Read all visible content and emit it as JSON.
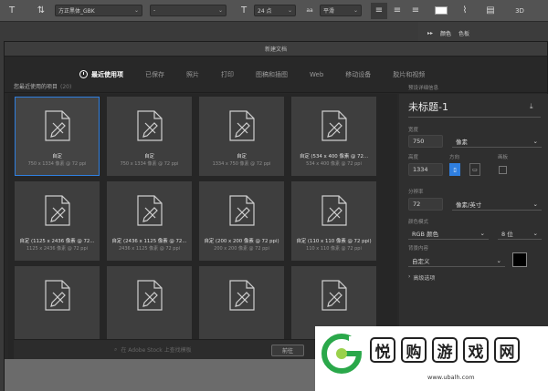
{
  "optbar": {
    "font_family": "方正黑体_GBK",
    "font_style": "-",
    "font_size": "24 点",
    "antialias": "平滑",
    "text_color": "#ffffff"
  },
  "right_panel": {
    "tab1": "颜色",
    "tab2": "色板"
  },
  "dialog": {
    "title": "新建文档",
    "tabs": [
      {
        "label": "最近使用项",
        "active": true
      },
      {
        "label": "已保存",
        "active": false
      },
      {
        "label": "照片",
        "active": false
      },
      {
        "label": "打印",
        "active": false
      },
      {
        "label": "图稿和插图",
        "active": false
      },
      {
        "label": "Web",
        "active": false
      },
      {
        "label": "移动设备",
        "active": false
      },
      {
        "label": "胶片和视频",
        "active": false
      }
    ],
    "recent_label": "您最近使用的项目",
    "recent_count": "(20)",
    "presets": [
      {
        "name": "自定",
        "dims": "750 x 1334 像素 @ 72 ppi",
        "selected": true
      },
      {
        "name": "自定",
        "dims": "750 x 1334 像素 @ 72 ppi",
        "selected": false
      },
      {
        "name": "自定",
        "dims": "1334 x 750 像素 @ 72 ppi",
        "selected": false
      },
      {
        "name": "自定 (534 x 400 像素 @ 72...",
        "dims": "534 x 400 像素 @ 72 ppi",
        "selected": false
      },
      {
        "name": "自定 (1125 x 2436 像素 @ 72...",
        "dims": "1125 x 2436 像素 @ 72 ppi",
        "selected": false
      },
      {
        "name": "自定 (2436 x 1125 像素 @ 72...",
        "dims": "2436 x 1125 像素 @ 72 ppi",
        "selected": false
      },
      {
        "name": "自定 (200 x 200 像素 @ 72 ppi)",
        "dims": "200 x 200 像素 @ 72 ppi",
        "selected": false
      },
      {
        "name": "自定 (110 x 110 像素 @ 72 ppi)",
        "dims": "110 x 110 像素 @ 72 ppi",
        "selected": false
      },
      {
        "name": "",
        "dims": "",
        "selected": false
      },
      {
        "name": "",
        "dims": "",
        "selected": false
      },
      {
        "name": "",
        "dims": "",
        "selected": false
      },
      {
        "name": "",
        "dims": "",
        "selected": false
      }
    ],
    "search_placeholder": "在 Adobe Stock 上查找模板",
    "go_button": "前往",
    "details": {
      "header": "预设详细信息",
      "doc_name": "未标题-1",
      "width_label": "宽度",
      "width_value": "750",
      "width_unit": "像素",
      "height_label": "高度",
      "height_value": "1334",
      "orientation_label": "方向",
      "artboard_label": "画板",
      "resolution_label": "分辨率",
      "resolution_value": "72",
      "resolution_unit": "像素/英寸",
      "color_mode_label": "颜色模式",
      "color_mode_value": "RGB 颜色",
      "bit_depth": "8 位",
      "bg_label": "背景内容",
      "bg_value": "自定义",
      "bg_color": "#000000",
      "advanced": "高级选项"
    }
  },
  "watermark": {
    "chars": [
      "悦",
      "购",
      "游",
      "戏",
      "网"
    ],
    "url": "www.ubalh.com",
    "brand_green": "#2aa84a"
  }
}
